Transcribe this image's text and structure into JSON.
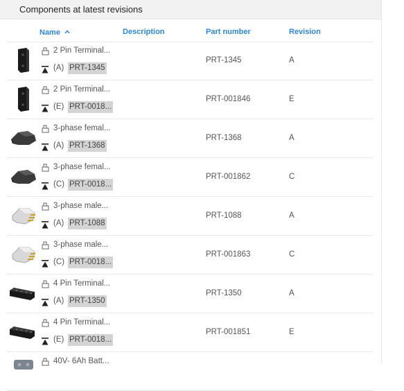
{
  "panel": {
    "title": "Components at latest revisions"
  },
  "columns": {
    "name": "Name",
    "description": "Description",
    "part_number": "Part number",
    "revision": "Revision"
  },
  "rows": [
    {
      "name": "2 Pin Terminal...",
      "rev_label": "(A)",
      "pn_badge": "PRT-1345",
      "description": "",
      "part_number": "PRT-1345",
      "revision": "A",
      "thumb": "terminal-2pin"
    },
    {
      "name": "2 Pin Terminal...",
      "rev_label": "(E)",
      "pn_badge": "PRT-0018...",
      "description": "",
      "part_number": "PRT-001846",
      "revision": "E",
      "thumb": "terminal-2pin"
    },
    {
      "name": "3-phase femal...",
      "rev_label": "(A)",
      "pn_badge": "PRT-1368",
      "description": "",
      "part_number": "PRT-1368",
      "revision": "A",
      "thumb": "plug-female"
    },
    {
      "name": "3-phase femal...",
      "rev_label": "(C)",
      "pn_badge": "PRT-0018...",
      "description": "",
      "part_number": "PRT-001862",
      "revision": "C",
      "thumb": "plug-female"
    },
    {
      "name": "3-phase male...",
      "rev_label": "(A)",
      "pn_badge": "PRT-1088",
      "description": "",
      "part_number": "PRT-1088",
      "revision": "A",
      "thumb": "plug-male"
    },
    {
      "name": "3-phase male...",
      "rev_label": "(C)",
      "pn_badge": "PRT-0018...",
      "description": "",
      "part_number": "PRT-001863",
      "revision": "C",
      "thumb": "plug-male"
    },
    {
      "name": "4 Pin Terminal...",
      "rev_label": "(A)",
      "pn_badge": "PRT-1350",
      "description": "",
      "part_number": "PRT-1350",
      "revision": "A",
      "thumb": "terminal-4pin"
    },
    {
      "name": "4 Pin Terminal...",
      "rev_label": "(E)",
      "pn_badge": "PRT-0018...",
      "description": "",
      "part_number": "PRT-001851",
      "revision": "E",
      "thumb": "terminal-4pin"
    },
    {
      "name": "40V- 6Ah Batt...",
      "rev_label": "",
      "pn_badge": "",
      "description": "",
      "part_number": "",
      "revision": "",
      "thumb": "battery"
    }
  ],
  "icons": {
    "sort": "sort-ascending-icon",
    "part_type": "part-studio-icon",
    "release": "released-status-icon"
  },
  "colors": {
    "accent": "#2f86d4",
    "badge_bg": "#d4d4d4",
    "titlebar_bg": "#f2f2f2"
  }
}
